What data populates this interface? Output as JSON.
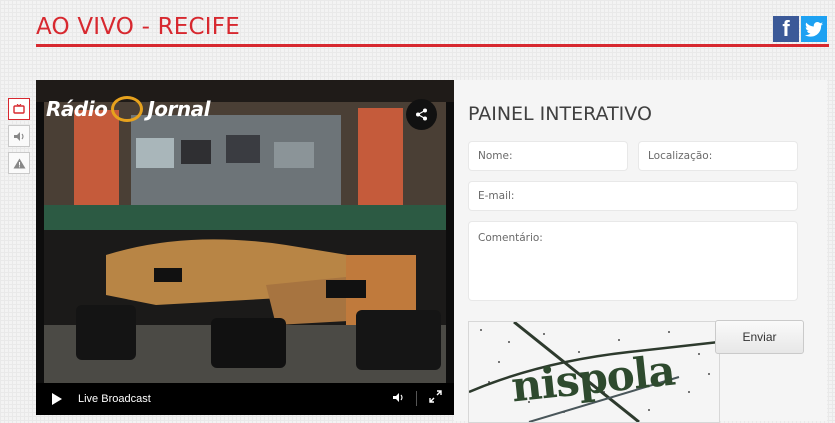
{
  "page": {
    "title": "AO VIVO - RECIFE",
    "colors": {
      "accent": "#d7282f",
      "facebook": "#3b5998",
      "twitter": "#1da1f2"
    }
  },
  "social": {
    "facebook_glyph": "f",
    "twitter_glyph": "🐦",
    "icons": [
      "facebook-icon",
      "twitter-icon"
    ]
  },
  "side_tools": [
    {
      "icon": "video-icon",
      "glyph": "▣"
    },
    {
      "icon": "audio-icon",
      "glyph": "🔈"
    },
    {
      "icon": "warning-icon",
      "glyph": "⚠"
    }
  ],
  "player": {
    "logo_text": "Rádio",
    "logo_text2": "Jornal",
    "live_label": "Live Broadcast"
  },
  "panel": {
    "title": "PAINEL INTERATIVO",
    "fields": {
      "name_placeholder": "Nome:",
      "location_placeholder": "Localização:",
      "email_placeholder": "E-mail:",
      "comment_placeholder": "Comentário:"
    },
    "captcha_text": "nispola",
    "send_label": "Enviar"
  }
}
